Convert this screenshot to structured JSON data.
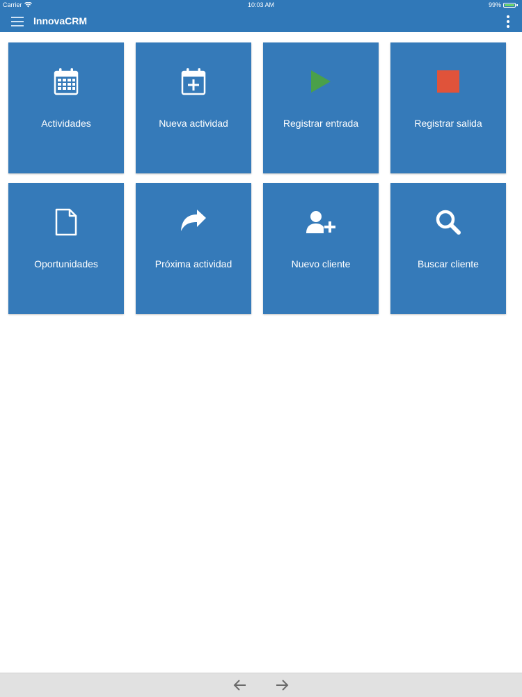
{
  "status_bar": {
    "carrier": "Carrier",
    "wifi_icon": "wifi-icon",
    "time": "10:03 AM",
    "battery_percent": "99%",
    "battery_level": 0.99
  },
  "app_bar": {
    "title": "InnovaCRM",
    "menu_icon": "hamburger-menu-icon",
    "overflow_icon": "more-vert-icon",
    "color": "#3078b8"
  },
  "tiles": [
    {
      "label": "Actividades",
      "icon": "calendar-icon"
    },
    {
      "label": "Nueva actividad",
      "icon": "calendar-plus-icon"
    },
    {
      "label": "Registrar entrada",
      "icon": "play-icon",
      "icon_color": "#4aa04a"
    },
    {
      "label": "Registrar salida",
      "icon": "stop-icon",
      "icon_color": "#e0533a"
    },
    {
      "label": "Oportunidades",
      "icon": "document-icon"
    },
    {
      "label": "Próxima actividad",
      "icon": "share-forward-icon"
    },
    {
      "label": "Nuevo cliente",
      "icon": "user-plus-icon"
    },
    {
      "label": "Buscar cliente",
      "icon": "search-icon"
    }
  ],
  "tile_color": "#357ab9",
  "bottom_bar": {
    "back_icon": "arrow-left-icon",
    "forward_icon": "arrow-right-icon"
  }
}
